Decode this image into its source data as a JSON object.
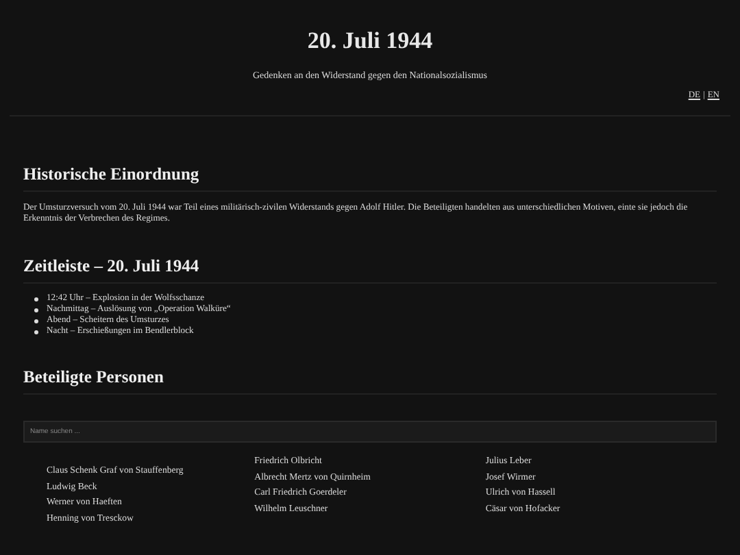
{
  "header": {
    "title": "20. Juli 1944",
    "subtitle": "Gedenken an den Widerstand gegen den Nationalsozialismus",
    "languages": [
      {
        "label": "DE"
      },
      {
        "label": "EN"
      }
    ],
    "separator": "|"
  },
  "context": {
    "heading": "Historische Einordnung",
    "text": "Der Umsturzversuch vom 20. Juli 1944 war Teil eines militärisch-zivilen Widerstands gegen Adolf Hitler. Die Beteiligten handelten aus unterschiedlichen Motiven, einte sie jedoch die Erkenntnis der Verbrechen des Regimes."
  },
  "timeline": {
    "heading": "Zeitleiste – 20. Juli 1944",
    "items": [
      "12:42 Uhr – Explosion in der Wolfsschanze",
      "Nachmittag – Auslösung von „Operation Walküre“",
      "Abend – Scheitern des Umsturzes",
      "Nacht – Erschießungen im Bendlerblock"
    ]
  },
  "persons": {
    "heading": "Beteiligte Personen",
    "search": {
      "placeholder": "Name suchen ..."
    },
    "columns": [
      [
        "Claus Schenk Graf von Stauffenberg",
        "Ludwig Beck",
        "Werner von Haeften",
        "Henning von Tresckow"
      ],
      [
        "Friedrich Olbricht",
        "Albrecht Mertz von Quirnheim",
        "Carl Friedrich Goerdeler",
        "Wilhelm Leuschner"
      ],
      [
        "Julius Leber",
        "Josef Wirmer",
        "Ulrich von Hassell",
        "Cäsar von Hofacker"
      ]
    ]
  }
}
